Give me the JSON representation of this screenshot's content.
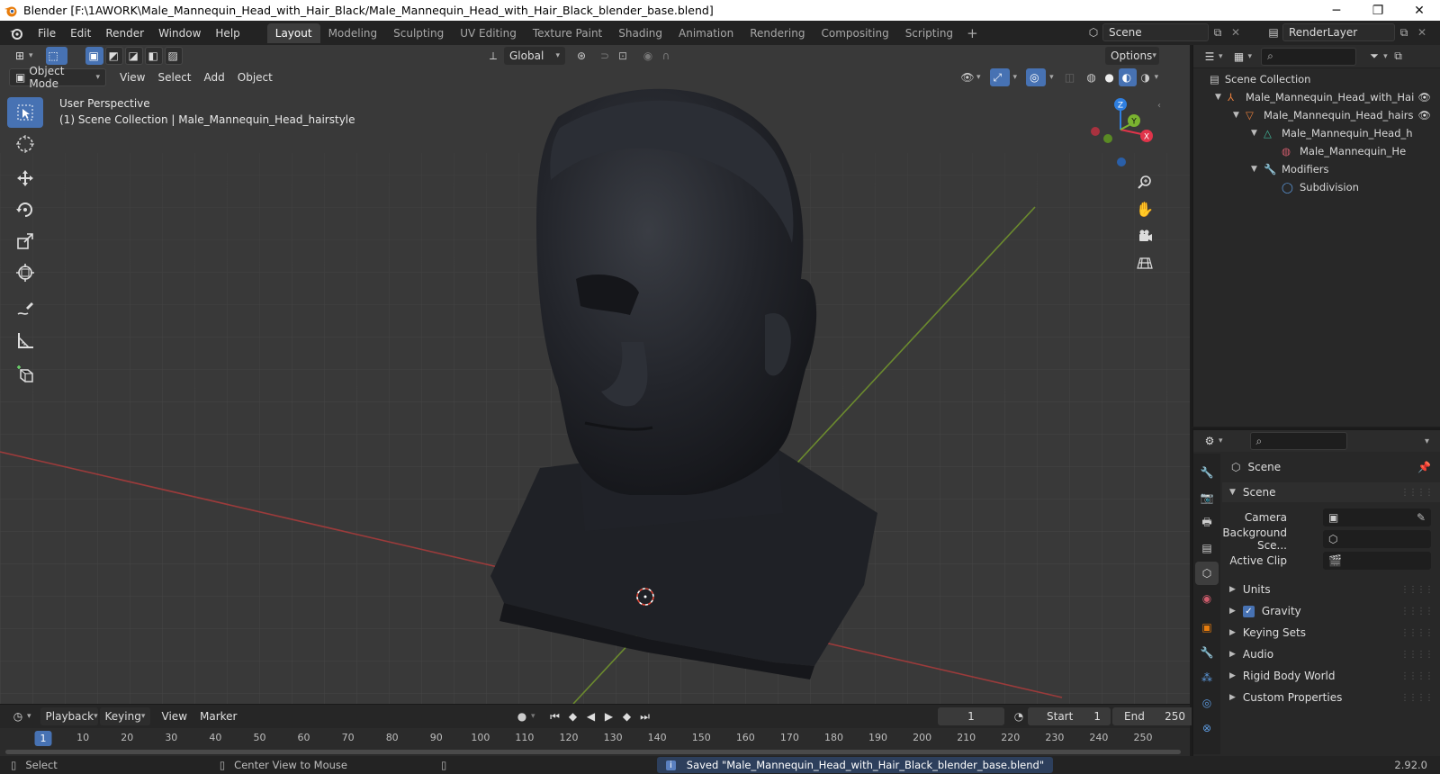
{
  "window": {
    "title": "Blender [F:\\1AWORK\\Male_Mannequin_Head_with_Hair_Black/Male_Mannequin_Head_with_Hair_Black_blender_base.blend]",
    "minimize": "─",
    "maximize": "❐",
    "close": "✕"
  },
  "menus": [
    "File",
    "Edit",
    "Render",
    "Window",
    "Help"
  ],
  "workspaces": [
    "Layout",
    "Modeling",
    "Sculpting",
    "UV Editing",
    "Texture Paint",
    "Shading",
    "Animation",
    "Rendering",
    "Compositing",
    "Scripting"
  ],
  "active_workspace": "Layout",
  "scene_field": "Scene",
  "renderlayer_field": "RenderLayer",
  "viewport": {
    "transform_orientation": "Global",
    "options_label": "Options",
    "mode": "Object Mode",
    "menus": [
      "View",
      "Select",
      "Add",
      "Object"
    ],
    "perspective_label": "User Perspective",
    "collection_label": "(1) Scene Collection | Male_Mannequin_Head_hairstyle",
    "gizmo_axes": {
      "x": "X",
      "y": "Y",
      "z": "Z"
    }
  },
  "timeline": {
    "menus": [
      "Playback",
      "Keying",
      "View",
      "Marker"
    ],
    "current_frame": "1",
    "start_label": "Start",
    "start_value": "1",
    "end_label": "End",
    "end_value": "250",
    "ticks": [
      "1",
      "10",
      "20",
      "30",
      "40",
      "50",
      "60",
      "70",
      "80",
      "90",
      "100",
      "110",
      "120",
      "130",
      "140",
      "150",
      "160",
      "170",
      "180",
      "190",
      "200",
      "210",
      "220",
      "230",
      "240",
      "250"
    ]
  },
  "statusbar": {
    "select": "Select",
    "center_view": "Center View to Mouse",
    "message": "Saved \"Male_Mannequin_Head_with_Hair_Black_blender_base.blend\"",
    "version": "2.92.0"
  },
  "outliner": {
    "root": "Scene Collection",
    "items": [
      {
        "label": "Male_Mannequin_Head_with_Hai",
        "depth": 1,
        "icon": "empty-icon",
        "color": "#e67e3c"
      },
      {
        "label": "Male_Mannequin_Head_hairs",
        "depth": 2,
        "icon": "mesh-object-icon",
        "color": "#e67e3c"
      },
      {
        "label": "Male_Mannequin_Head_h",
        "depth": 3,
        "icon": "mesh-data-icon",
        "color": "#41b89b"
      },
      {
        "label": "Male_Mannequin_He",
        "depth": 4,
        "icon": "material-icon",
        "color": "#d05c6c"
      },
      {
        "label": "Modifiers",
        "depth": 3,
        "icon": "wrench-icon",
        "color": "#5d9be0"
      },
      {
        "label": "Subdivision",
        "depth": 4,
        "icon": "subdivision-icon",
        "color": "#5d9be0"
      }
    ]
  },
  "properties": {
    "context": "Scene",
    "panel_title": "Scene",
    "camera_label": "Camera",
    "background_label": "Background Sce...",
    "clip_label": "Active Clip",
    "subpanels": [
      "Units",
      "Gravity",
      "Keying Sets",
      "Audio",
      "Rigid Body World",
      "Custom Properties"
    ],
    "gravity_checked": true
  }
}
